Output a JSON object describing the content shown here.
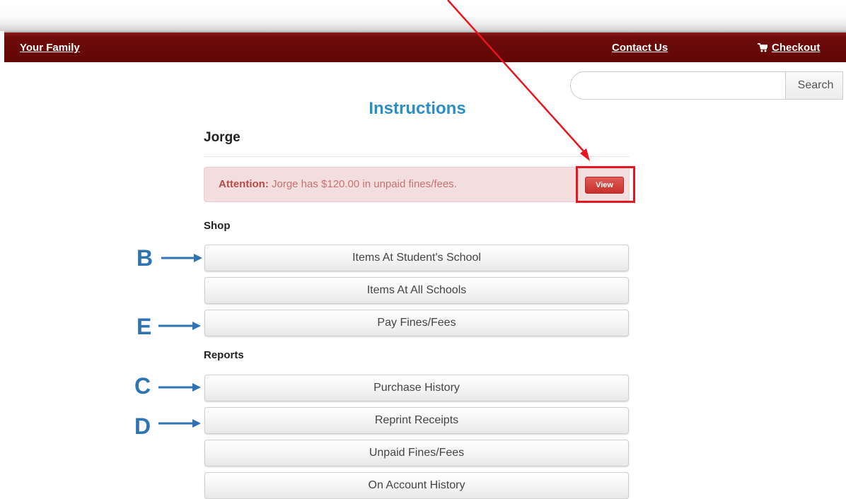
{
  "nav": {
    "your_family": "Your Family",
    "contact_us": "Contact Us",
    "checkout": "Checkout",
    "checkout_icon": "cart-icon",
    "bar_color": "#660808"
  },
  "search": {
    "placeholder": "",
    "button_label": "Search"
  },
  "page": {
    "title": "Instructions",
    "student_name": "Jorge"
  },
  "alert": {
    "prefix": "Attention:",
    "message": " Jorge has $120.00 in unpaid fines/fees.",
    "view_label": "View"
  },
  "shop": {
    "heading": "Shop",
    "items": [
      {
        "label": "Items At Student's School"
      },
      {
        "label": "Items At All Schools"
      },
      {
        "label": "Pay Fines/Fees"
      }
    ]
  },
  "reports": {
    "heading": "Reports",
    "items": [
      {
        "label": "Purchase History"
      },
      {
        "label": "Reprint Receipts"
      },
      {
        "label": "Unpaid Fines/Fees"
      },
      {
        "label": "On Account History"
      }
    ]
  },
  "annotations": {
    "letters": [
      "B",
      "E",
      "C",
      "D"
    ],
    "arrow_color": "#2e74b5",
    "highlight_color": "#e8141f"
  }
}
